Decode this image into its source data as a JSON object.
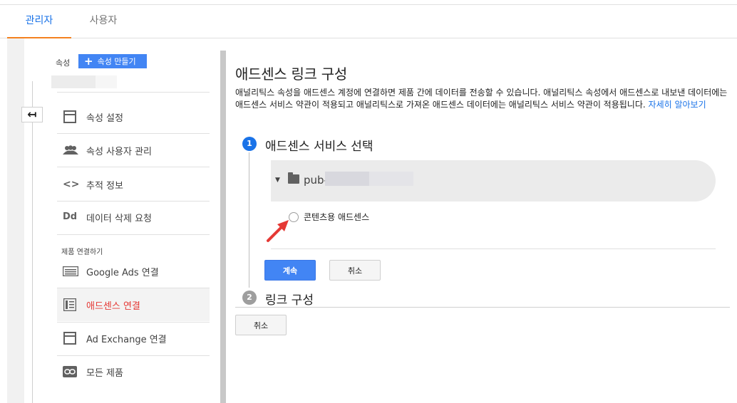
{
  "tabs": [
    {
      "label": "관리자",
      "active": true
    },
    {
      "label": "사용자",
      "active": false
    }
  ],
  "sidebar": {
    "property_label": "속성",
    "create_property_label": "속성 만들기",
    "items": [
      {
        "label": "속성 설정",
        "icon": "property-settings-icon"
      },
      {
        "label": "속성 사용자 관리",
        "icon": "people-icon"
      },
      {
        "label": "추적 정보",
        "icon": "code-brackets-icon"
      },
      {
        "label": "데이터 삭제 요청",
        "icon": "dd-icon"
      }
    ],
    "section_title": "제품 연결하기",
    "link_items": [
      {
        "label": "Google Ads 연결",
        "icon": "google-ads-icon"
      },
      {
        "label": "애드센스 연결",
        "icon": "adsense-icon",
        "active": true
      },
      {
        "label": "Ad Exchange 연결",
        "icon": "ad-exchange-icon"
      },
      {
        "label": "모든 제품",
        "icon": "link-icon"
      }
    ],
    "back_icon": "back-arrow-icon",
    "dd_glyph": "Dd",
    "code_glyph": "<>"
  },
  "main": {
    "title": "애드센스 링크 구성",
    "description": "애널리틱스 속성을 애드센스 계정에 연결하면 제품 간에 데이터를 전송할 수 있습니다. 애널리틱스 속성에서 애드센스로 내보낸 데이터에는 애드센스 서비스 약관이 적용되고 애널리틱스로 가져온 애드센스 데이터에는 애널리틱스 서비스 약관이 적용됩니다.",
    "learn_more": "자세히 알아보기",
    "step1": {
      "number": "1",
      "title": "애드센스 서비스 선택"
    },
    "step2": {
      "number": "2",
      "title": "링크 구성"
    },
    "account_prefix": "pub-",
    "radio_label": "콘텐츠용 애드센스",
    "continue_label": "계속",
    "cancel_label": "취소",
    "bottom_cancel_label": "취소"
  },
  "colors": {
    "accent": "#1a73e8",
    "primary_button": "#4285f4",
    "active_nav": "#e53935",
    "tab_underline": "#f4811f",
    "arrow": "#e53935"
  }
}
